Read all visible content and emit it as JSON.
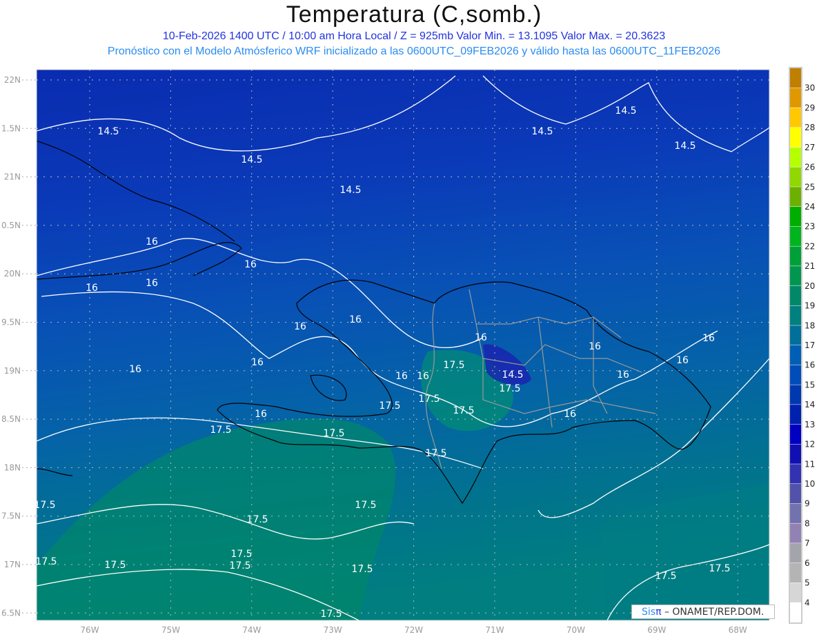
{
  "title": "Temperatura (C,somb.)",
  "subtitle_line1": "10-Feb-2026  1400 UTC / 10:00 am Hora Local / Z = 925mb   Valor Min. = 13.1095  Valor Max. = 20.3623",
  "subtitle_line2": "Pronóstico con el Modelo Atmósferico WRF inicializado a las 0600UTC_09FEB2026 y válido hasta las  0600UTC_11FEB2026",
  "map": {
    "lat_labels": [
      "22N",
      "1.5N",
      "21N",
      "0.5N",
      "20N",
      "9.5N",
      "19N",
      "8.5N",
      "18N",
      "7.5N",
      "17N",
      "6.5N"
    ],
    "lon_labels": [
      "76W",
      "75W",
      "74W",
      "73W",
      "72W",
      "71W",
      "70W",
      "69W",
      "68W"
    ],
    "contour_labels": [
      "14.5",
      "14.5",
      "14.5",
      "14.5",
      "14.5",
      "14.5",
      "16",
      "16",
      "16",
      "16",
      "16",
      "16",
      "16",
      "16",
      "16",
      "16",
      "16",
      "16",
      "16",
      "16",
      "16",
      "16",
      "16",
      "14.5",
      "17.5",
      "17.5",
      "17.5",
      "17.5",
      "17.5",
      "17.5",
      "17.5",
      "17.5",
      "17.5",
      "17.5",
      "17.5",
      "17.5",
      "17.5",
      "17.5",
      "17.5",
      "17.5",
      "17.5",
      "17.5"
    ]
  },
  "colorbar": {
    "labels": [
      "30",
      "29",
      "28",
      "27",
      "26",
      "25",
      "24",
      "23",
      "22",
      "21",
      "20",
      "19",
      "18",
      "17",
      "16",
      "15",
      "14",
      "13",
      "12",
      "11",
      "10",
      "9",
      "8",
      "7",
      "6",
      "5",
      "4"
    ],
    "colors": [
      "#bf7f00",
      "#e09800",
      "#ffc800",
      "#ffff00",
      "#b6ff00",
      "#90d800",
      "#6cb000",
      "#00ae00",
      "#00b41e",
      "#00a038",
      "#009650",
      "#008868",
      "#00807e",
      "#006f9a",
      "#005eb4",
      "#004cba",
      "#0038b0",
      "#0020b0",
      "#0000c2",
      "#1010b2",
      "#3232b2",
      "#5252aa",
      "#7272ae",
      "#9282b4",
      "#a4a4ac",
      "#b4b4b4",
      "#d6d6d6",
      "#ffffff"
    ]
  },
  "watermark": {
    "brand_a": "Sis",
    "brand_b": "π",
    "text": " – ONAMET/REP.DOM."
  }
}
